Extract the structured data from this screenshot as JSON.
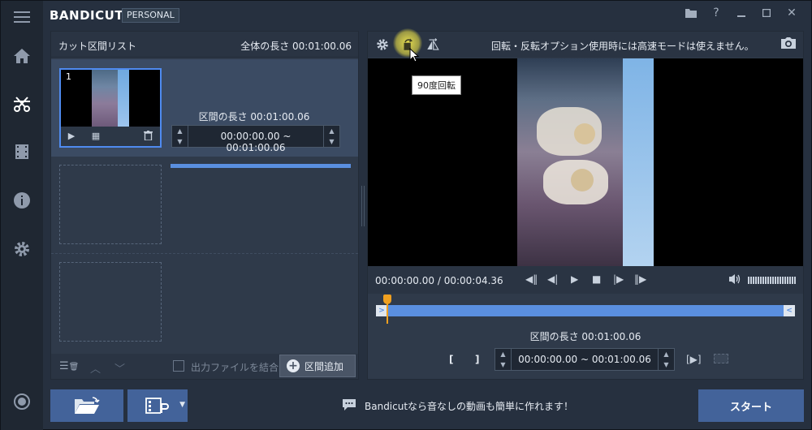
{
  "app": {
    "brand": "BANDICUT",
    "edition": "PERSONAL"
  },
  "segment_list": {
    "title": "カット区間リスト",
    "total_length": "全体の長さ 00:01:00.06",
    "segment": {
      "number": "1",
      "length": "区間の長さ 00:01:00.06",
      "start": "00:00:00.00",
      "separator": "~",
      "end": "00:01:00.06"
    },
    "footer": {
      "merge_label": "出力ファイルを結合",
      "add_label": "区間追加"
    }
  },
  "preview": {
    "warning": "回転・反転オプション使用時には高速モードは使えません。",
    "tooltip": "90度回転",
    "current_time": "00:00:00.00",
    "time_sep": "/",
    "duration": "00:00:04.36",
    "segment_length": "区間の長さ 00:01:00.06",
    "range_start": "00:00:00.00",
    "range_sep": "~",
    "range_end": "00:01:00.06"
  },
  "bottom": {
    "tip": "Bandicutなら音なしの動画も簡単に作れます！",
    "start_label": "スタート"
  },
  "colors": {
    "accent": "#5a8fe0",
    "button": "#43639a",
    "playhead": "#f0a020"
  }
}
